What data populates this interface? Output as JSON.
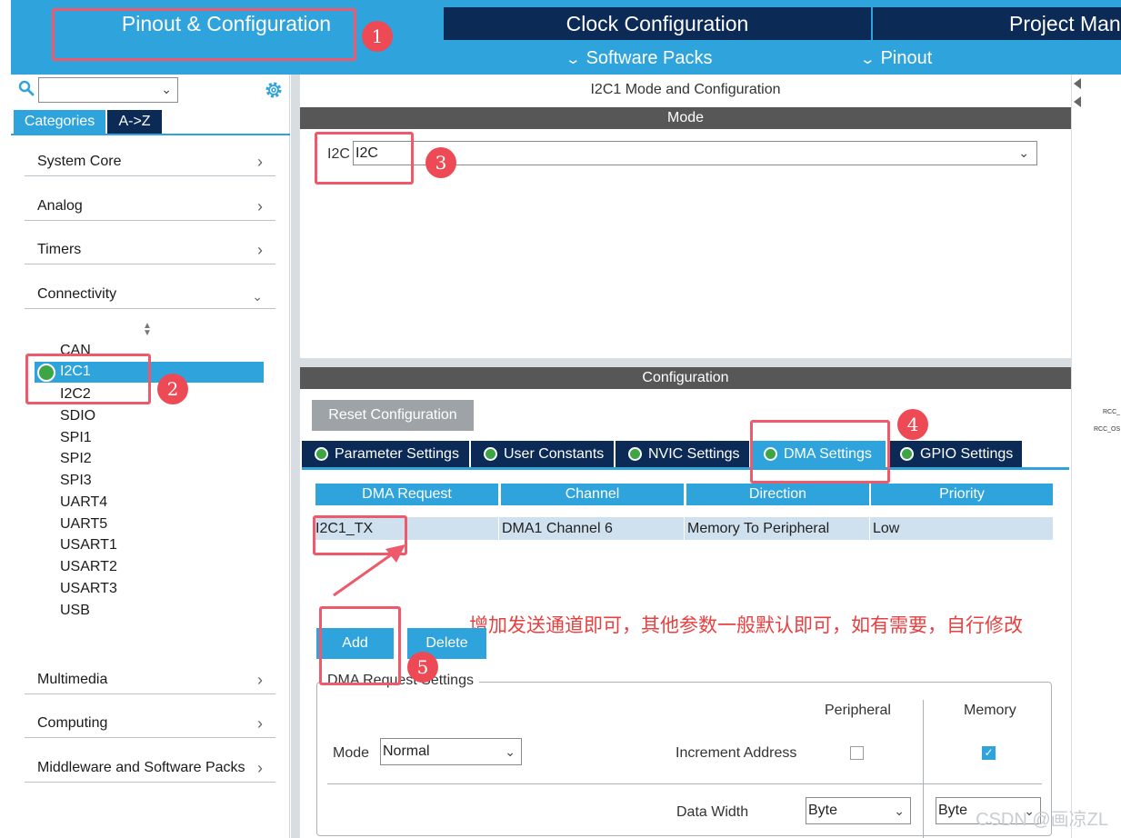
{
  "top_tabs": [
    {
      "label": "Pinout & Configuration"
    },
    {
      "label": "Clock Configuration"
    },
    {
      "label": "Project Man"
    }
  ],
  "sub_menu": [
    {
      "label": "Software Packs"
    },
    {
      "label": "Pinout"
    }
  ],
  "left": {
    "search_value": "",
    "category_tabs": [
      "Categories",
      "A->Z"
    ],
    "categories_top": [
      {
        "label": "System Core"
      },
      {
        "label": "Analog"
      },
      {
        "label": "Timers"
      },
      {
        "label": "Connectivity"
      }
    ],
    "peripherals": [
      "CAN",
      "I2C1",
      "I2C2",
      "SDIO",
      "SPI1",
      "SPI2",
      "SPI3",
      "UART4",
      "UART5",
      "USART1",
      "USART2",
      "USART3",
      "USB"
    ],
    "selected": "I2C1",
    "categories_bottom": [
      {
        "label": "Multimedia"
      },
      {
        "label": "Computing"
      },
      {
        "label": "Middleware and Software Packs"
      }
    ]
  },
  "mode_panel": {
    "title": "I2C1 Mode and Configuration",
    "section": "Mode",
    "label": "I2C",
    "value": "I2C"
  },
  "config": {
    "section": "Configuration",
    "reset_label": "Reset Configuration",
    "tabs": [
      {
        "label": "Parameter Settings",
        "active": false
      },
      {
        "label": "User Constants",
        "active": false
      },
      {
        "label": "NVIC Settings",
        "active": false
      },
      {
        "label": "DMA Settings",
        "active": true
      },
      {
        "label": "GPIO Settings",
        "active": false
      }
    ],
    "dma_table": {
      "headers": [
        "DMA Request",
        "Channel",
        "Direction",
        "Priority"
      ],
      "rows": [
        [
          "I2C1_TX",
          "DMA1 Channel 6",
          "Memory To Peripheral",
          "Low"
        ]
      ]
    },
    "add_label": "Add",
    "delete_label": "Delete",
    "note": "增加发送通道即可，其他参数一般默认即可，如有需要，自行修改",
    "request_settings": {
      "legend": "DMA Request Settings",
      "peripheral_head": "Peripheral",
      "memory_head": "Memory",
      "mode_label": "Mode",
      "mode_value": "Normal",
      "increment_label": "Increment Address",
      "peripheral_increment": false,
      "memory_increment": true,
      "data_width_label": "Data Width",
      "peripheral_width": "Byte",
      "memory_width": "Byte"
    }
  },
  "right_edge": {
    "labels": [
      "RCC_",
      "RCC_OS"
    ]
  },
  "annotations": [
    "1",
    "2",
    "3",
    "4",
    "5"
  ],
  "watermark": "CSDN @画凉ZL",
  "colors": {
    "accent": "#2ea3dc",
    "dark": "#0b2a55",
    "annotation": "#ee5a6b"
  }
}
